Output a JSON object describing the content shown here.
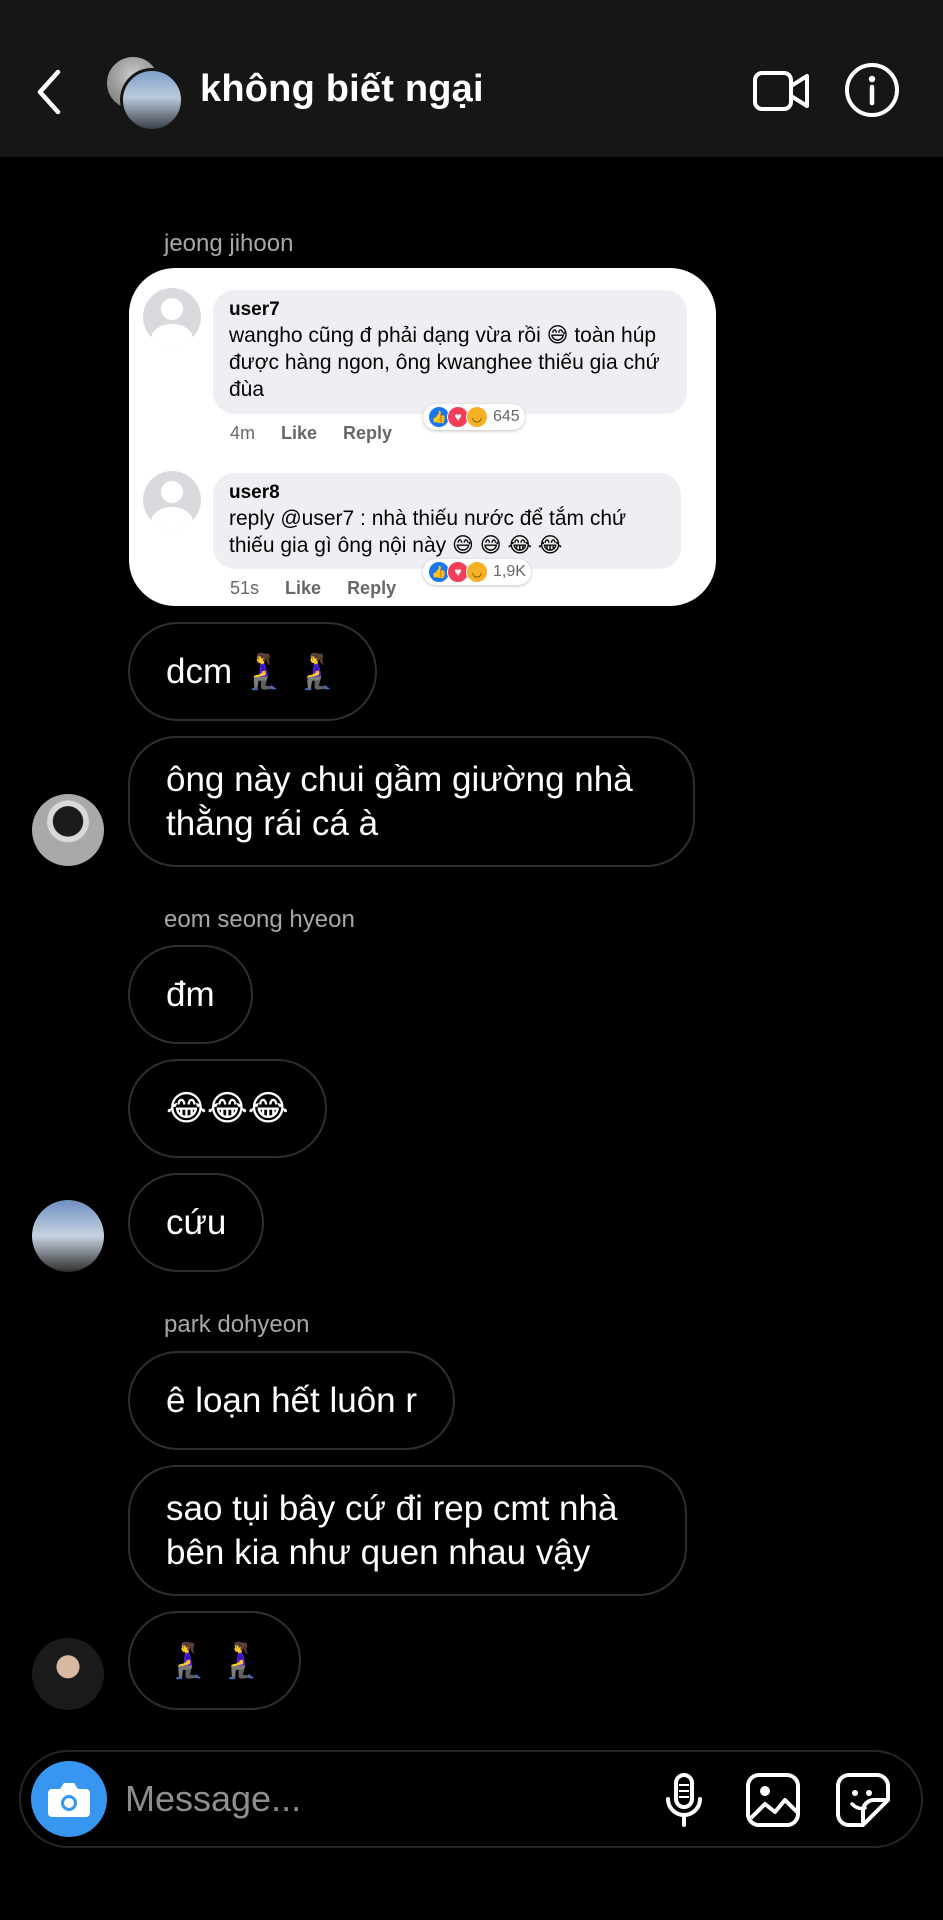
{
  "header": {
    "title": "không biết ngại"
  },
  "shared_image": {
    "comments": [
      {
        "user": "user7",
        "text": "wangho cũng đ phải dạng vừa rồi 😅 toàn húp được hàng ngon, ông kwanghee thiếu gia chứ đùa",
        "time": "4m",
        "like": "Like",
        "reply": "Reply",
        "reactions": "645"
      },
      {
        "user": "user8",
        "text": "reply @user7 : nhà thiếu nước để tắm chứ thiếu gia gì ông nội này 😅 😅 😂 😂",
        "time": "51s",
        "like": "Like",
        "reply": "Reply",
        "reactions": "1,9K"
      }
    ]
  },
  "messages": {
    "sender1": "jeong jihoon",
    "m1": "dcm 🧎‍♀️ 🧎‍♀️",
    "m2": "ông này chui gầm giường nhà thằng rái cá à",
    "sender2": "eom seong hyeon",
    "m3": "đm",
    "m4": "😂😂😂",
    "m5": "cứu",
    "sender3": "park dohyeon",
    "m6": "ê loạn hết luôn r",
    "m7": "sao tụi bây cứ đi rep cmt nhà bên kia như quen nhau vậy",
    "m8": "🧎‍♀️ 🧎‍♀️"
  },
  "composer": {
    "placeholder": "Message..."
  },
  "colors": {
    "background": "#000000",
    "header": "#161616",
    "bubble_border": "#2f2f2f",
    "accent": "#3797f0"
  },
  "icons": [
    "chevron-left-icon",
    "video-camera-icon",
    "info-icon",
    "camera-icon",
    "microphone-icon",
    "gallery-icon",
    "sticker-icon"
  ]
}
